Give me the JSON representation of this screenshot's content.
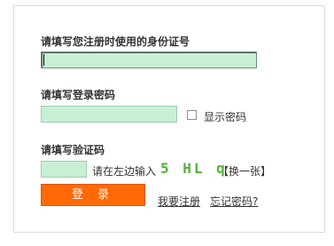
{
  "form": {
    "id_label": "请填写您注册时使用的身份证号",
    "id_value": "",
    "password_label": "请填写登录密码",
    "password_value": "",
    "show_password_label": "显示密码",
    "captcha_label": "请填写验证码",
    "captcha_value": "",
    "captcha_hint": "请在左边输入",
    "captcha_text": "5 HL q",
    "refresh_captcha": "【换一张】",
    "login_button": "登 录",
    "register_link": "我要注册",
    "forgot_password_link": "忘记密码?"
  },
  "colors": {
    "field_bg": "#c8efd4",
    "button_bg": "#ff6a06",
    "captcha_color": "#55b13b"
  }
}
